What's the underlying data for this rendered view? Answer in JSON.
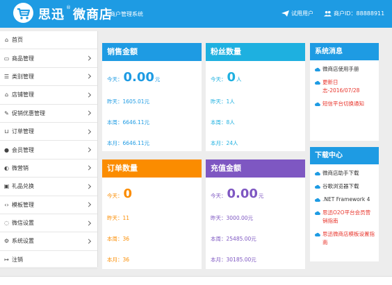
{
  "header": {
    "brand": "思迅",
    "brand_suffix": "微商店",
    "subtitle": "商户管理系统",
    "trial_label": "试用用户",
    "merchant_label": "商户ID：88888911"
  },
  "sidebar": {
    "items": [
      {
        "label": "首页",
        "icon": "home-icon"
      },
      {
        "label": "商品管理",
        "icon": "credit-card-icon"
      },
      {
        "label": "类别管理",
        "icon": "list-icon"
      },
      {
        "label": "店铺管理",
        "icon": "bank-icon"
      },
      {
        "label": "促销优惠管理",
        "icon": "pin-icon"
      },
      {
        "label": "订单管理",
        "icon": "cart-icon"
      },
      {
        "label": "会员管理",
        "icon": "user-icon"
      },
      {
        "label": "微营销",
        "icon": "chat-icon"
      },
      {
        "label": "礼品兑换",
        "icon": "gift-icon"
      },
      {
        "label": "模板管理",
        "icon": "code-icon"
      },
      {
        "label": "微信设置",
        "icon": "wechat-icon"
      },
      {
        "label": "系统设置",
        "icon": "cogs-icon"
      },
      {
        "label": "注销",
        "icon": "logout-icon"
      }
    ]
  },
  "cards": {
    "sales": {
      "title": "销售金额",
      "color": "#1e9be3",
      "today_label": "今天：",
      "today_value": "0.00",
      "today_unit": "元",
      "yesterday": "昨天：1605.01元",
      "week": "本周：6646.11元",
      "month": "本月：6646.11元"
    },
    "fans": {
      "title": "粉丝数量",
      "color": "#1eb0e0",
      "today_label": "今天：",
      "today_value": "0",
      "today_unit": "人",
      "yesterday": "昨天：1人",
      "week": "本周：8人",
      "month": "本月：24人"
    },
    "orders": {
      "title": "订单数量",
      "color": "#fb8c00",
      "today_label": "今天：",
      "today_value": "0",
      "today_unit": "",
      "yesterday": "昨天：11",
      "week": "本周：36",
      "month": "本月：36"
    },
    "recharge": {
      "title": "充值金额",
      "color": "#7e57c2",
      "today_label": "今天：",
      "today_value": "0.00",
      "today_unit": "元",
      "yesterday": "昨天：3000.00元",
      "week": "本周：25485.00元",
      "month": "本月：30185.00元"
    }
  },
  "messages": {
    "title": "系统消息",
    "items": [
      {
        "text": "微商店使用手册",
        "color": "dark"
      },
      {
        "text": "更新日志-2016/07/28",
        "color": "red"
      },
      {
        "text": "短信平台切换通知",
        "color": "red"
      }
    ]
  },
  "downloads": {
    "title": "下载中心",
    "items": [
      {
        "text": "微商店助手下载",
        "color": "dark"
      },
      {
        "text": "谷歌浏览器下载",
        "color": "dark"
      },
      {
        "text": ".NET Framework 4",
        "color": "dark"
      },
      {
        "text": "思迅O2O平台会员营销指南",
        "color": "red"
      },
      {
        "text": "思迅微商店模板设置指南",
        "color": "red"
      }
    ]
  }
}
